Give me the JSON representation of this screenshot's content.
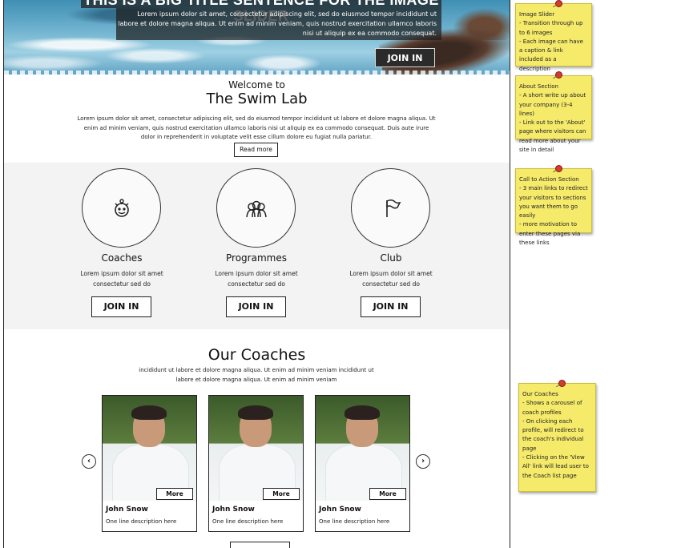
{
  "hero": {
    "title": "THIS IS A BIG TITLE SENTENCE FOR THE IMAGE SLIDER",
    "subtitle": "Lorem ipsum dolor sit amet, consectetur adipiscing elit, sed do eiusmod tempor incididunt ut labore et dolore magna aliqua. Ut enim ad minim veniam, quis nostrud exercitation ullamco laboris nisi ut aliquip ex ea commodo consequat.",
    "join_label": "JOIN IN"
  },
  "welcome": {
    "small": "Welcome to",
    "title": "The Swim Lab",
    "body": "Lorem ipsum dolor sit amet, consectetur adipiscing elit, sed do eiusmod tempor incididunt ut labore et dolore magna aliqua. Ut enim ad minim veniam, quis nostrud exercitation ullamco laboris nisi ut aliquip ex ea commodo consequat. Duis aute irure dolor in reprehenderit in voluptate velit esse cillum dolore eu fugiat nulla pariatur.",
    "read_more": "Read more"
  },
  "cta": [
    {
      "title": "Coaches",
      "desc": "Lorem ipsum dolor sit amet consectetur sed do",
      "join": "JOIN IN",
      "icon": "coach-whistle-icon"
    },
    {
      "title": "Programmes",
      "desc": "Lorem ipsum dolor sit amet consectetur sed do",
      "join": "JOIN IN",
      "icon": "people-group-icon"
    },
    {
      "title": "Club",
      "desc": "Lorem ipsum dolor sit amet consectetur sed do",
      "join": "JOIN IN",
      "icon": "flag-icon"
    }
  ],
  "coaches": {
    "title": "Our Coaches",
    "subtitle": "incididunt ut labore et dolore magna aliqua. Ut enim ad minim veniam incididunt ut labore et dolore magna aliqua. Ut enim ad minim veniam",
    "cards": [
      {
        "name": "John Snow",
        "desc": "One line description here",
        "more": "More"
      },
      {
        "name": "John Snow",
        "desc": "One line description here",
        "more": "More"
      },
      {
        "name": "John Snow",
        "desc": "One line description here",
        "more": "More"
      }
    ],
    "prev_arrow": "‹",
    "next_arrow": "›"
  },
  "notes": [
    {
      "lines": [
        "Image Slider",
        "- Transition through up to 6 images",
        "- Each image can have a caption & link included as a description"
      ]
    },
    {
      "lines": [
        "About Section",
        "- A short write up about your company (3-4 lines)",
        "- Link out to the 'About' page where visitors can read more about your site in detail"
      ]
    },
    {
      "lines": [
        "Call to Action Section",
        "- 3 main links to redirect your visitors to sections you want them to go easily",
        "- more motivation to enter these pages via these links"
      ]
    },
    {
      "lines": [
        "Our Coaches",
        "- Shows a carousel of coach profiles",
        "- On clicking each profile, will redirect to the coach's individual page",
        "- Clicking on the 'View All' link will lead user to the Coach list page"
      ]
    }
  ],
  "colors": {
    "note_yellow": "#f5ea6a",
    "pin_red": "#d93a2b",
    "band_gray": "#f3f3f3"
  }
}
